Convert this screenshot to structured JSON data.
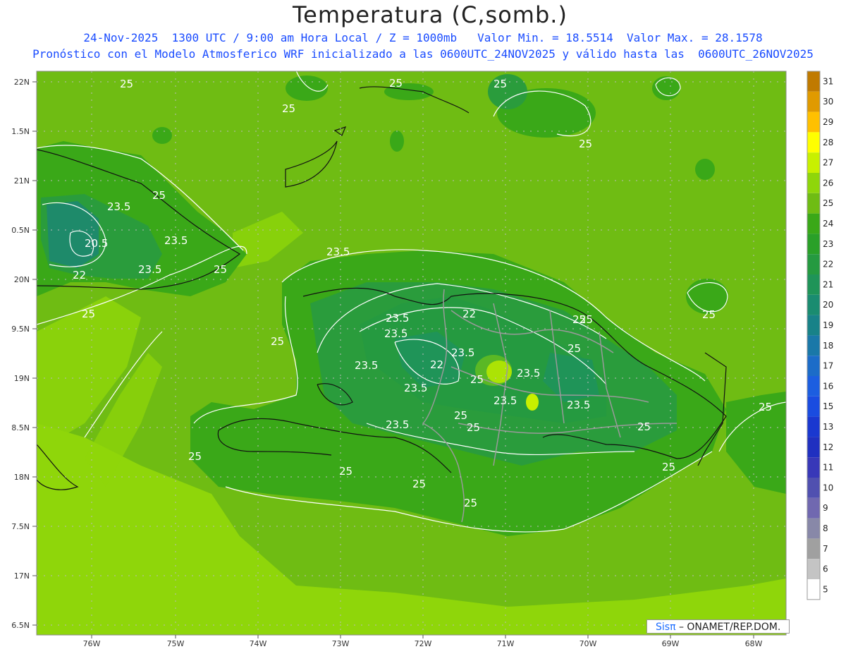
{
  "header": {
    "title": "Temperatura (C,somb.)",
    "line1": "24-Nov-2025  1300 UTC / 9:00 am Hora Local / Z = 1000mb   Valor Min. = 18.5514  Valor Max. = 28.1578",
    "line2": "Pronóstico con el Modelo Atmosferico WRF inicializado a las 0600UTC_24NOV2025 y válido hasta las  0600UTC_26NOV2025"
  },
  "map": {
    "lat_ticks": [
      "22N",
      "1.5N",
      "21N",
      "0.5N",
      "20N",
      "9.5N",
      "19N",
      "8.5N",
      "18N",
      "7.5N",
      "17N",
      "6.5N"
    ],
    "lon_ticks": [
      "76W",
      "75W",
      "74W",
      "73W",
      "72W",
      "71W",
      "70W",
      "69W",
      "68W"
    ],
    "contour_labels": [
      "25",
      "25",
      "25",
      "25",
      "25",
      "23.5",
      "25",
      "23.5",
      "20.5",
      "23.5",
      "22",
      "23.5",
      "25",
      "25",
      "25",
      "23.5",
      "23.5",
      "22",
      "25",
      "23.5",
      "25",
      "23.5",
      "22",
      "25",
      "23.5",
      "25",
      "23.5",
      "23.5",
      "25",
      "23.5",
      "25",
      "25",
      "23.5",
      "25",
      "25",
      "25",
      "25",
      "25",
      "25",
      "25"
    ],
    "colors": {
      "sea": "#8fd60a",
      "land_low": "#6fbc13",
      "land_mid": "#3aa818",
      "land_cool": "#2a9c3c",
      "land_cold": "#1e8a6a",
      "coast": "#111111",
      "border": "#9a9a9a"
    }
  },
  "colorbar": {
    "labels": [
      "31",
      "30",
      "29",
      "28",
      "27",
      "26",
      "25",
      "24",
      "23",
      "22",
      "21",
      "20",
      "19",
      "18",
      "17",
      "16",
      "15",
      "13",
      "12",
      "11",
      "10",
      "9",
      "8",
      "7",
      "6",
      "5"
    ],
    "colors": [
      "#c07a00",
      "#e09a00",
      "#ffc000",
      "#ffff00",
      "#c8f000",
      "#8fd60a",
      "#6fbc13",
      "#3aa818",
      "#2aa028",
      "#259a40",
      "#1f9458",
      "#1a8c70",
      "#188288",
      "#1a78a8",
      "#1c6cc8",
      "#1c5ee0",
      "#1a4ce0",
      "#1a38d0",
      "#2030c0",
      "#3838b8",
      "#5050b0",
      "#7068b0",
      "#8888a8",
      "#a0a0a0",
      "#c4c4c4",
      "#ffffff"
    ]
  },
  "credit": {
    "brand": "Sisπ",
    "text": "– ONAMET/REP.DOM."
  }
}
